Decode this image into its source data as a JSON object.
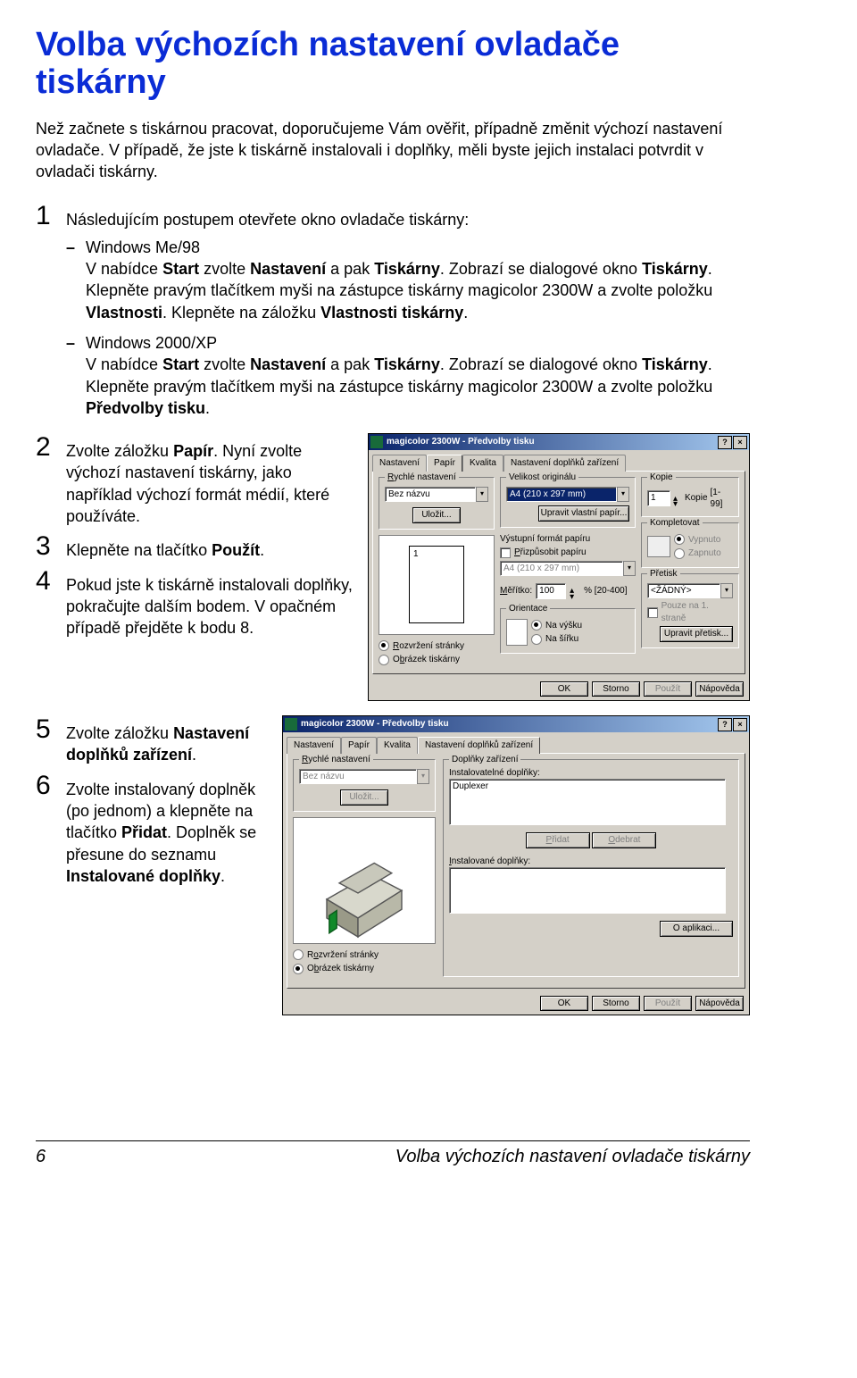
{
  "heading": "Volba výchozích nastavení ovladače tiskárny",
  "lead": "Než začnete s tiskárnou pracovat, doporučujeme Vám ověřit, případně změnit výchozí nastavení ovladače. V případě, že jste k tiskárně instalovali i doplňky, měli byste jejich instalaci potvrdit v ovladači tiskárny.",
  "step1": {
    "intro": "Následujícím postupem otevřete okno ovladače tiskárny:",
    "a_title": "Windows Me/98",
    "a_text_before_start": "V nabídce ",
    "a_start": "Start",
    "a_mid1": " zvolte ",
    "a_nastaveni": "Nastavení",
    "a_mid2": " a pak ",
    "a_tiskarny": "Tiskárny",
    "a_after1": ". Zobrazí se dialogové okno ",
    "a_tiskarny2": "Tiskárny",
    "a_after2": ". Klepněte pravým tlačítkem myši na zástupce tiskárny magicolor 2300W a zvolte položku ",
    "a_vlast": "Vlastnosti",
    "a_after3": ". Klepněte na záložku ",
    "a_vlast_tisk": "Vlastnosti tiskárny",
    "a_end": ".",
    "b_title": "Windows 2000/XP",
    "b_before": "V nabídce ",
    "b_start": "Start",
    "b_mid1": " zvolte ",
    "b_nastaveni": "Nastavení",
    "b_mid2": " a pak ",
    "b_tiskarny": "Tiskárny",
    "b_after1": ". Zobrazí se dialogové okno ",
    "b_tiskarny2": "Tiskárny",
    "b_after2": ". Klepněte pravým tlačítkem myši na zástupce tiskárny magicolor 2300W a zvolte položku ",
    "b_predvolby": "Předvolby tisku",
    "b_end": "."
  },
  "step2": {
    "before": "Zvolte záložku ",
    "papir": "Papír",
    "after": ". Nyní zvolte výchozí nastavení tiskárny, jako například výchozí formát médií, které používáte."
  },
  "step3": {
    "before": "Klepněte na tlačítko ",
    "pouzit": "Použít",
    "after": "."
  },
  "step4": "Pokud jste k tiskárně instalovali doplňky, pokračujte dalším bodem. V opačném případě přejděte k bodu 8.",
  "step5": {
    "before": "Zvolte záložku ",
    "nast": "Nastavení doplňků zařízení",
    "after": "."
  },
  "step6": {
    "t1": "Zvolte instalovaný doplněk (po jednom) a klepněte na tlačítko ",
    "pridat": "Přidat",
    "t2": ". Doplněk se přesune do seznamu ",
    "inst": "Instalované doplňky",
    "t3": "."
  },
  "dialog1": {
    "title": "magicolor 2300W - Předvolby tisku",
    "tabs": [
      "Nastavení",
      "Papír",
      "Kvalita",
      "Nastavení doplňků zařízení"
    ],
    "active_tab": 1,
    "quick_label": "Rychlé nastavení",
    "quick_value": "Bez názvu",
    "save_btn": "Uložit...",
    "orig_label": "Velikost originálu",
    "orig_value": "A4 (210 x 297 mm)",
    "custom_btn": "Upravit vlastní papír...",
    "out_label": "Výstupní formát papíru",
    "fit_chk": "Přizpůsobit papíru",
    "out_value": "A4 (210 x 297 mm)",
    "scale_label": "Měřítko:",
    "scale_value": "100",
    "scale_range": "%   [20-400]",
    "orient_label": "Orientace",
    "orient_portrait": "Na výšku",
    "orient_landscape": "Na šířku",
    "copies_label": "Kopie",
    "copies_value": "1",
    "copies_text": "Kopie",
    "copies_range": "[1-99]",
    "collate_label": "Kompletovat",
    "collate_off": "Vypnuto",
    "collate_on": "Zapnuto",
    "overlay_label": "Přetisk",
    "overlay_value": "<ŽÁDNÝ>",
    "overlay_first": "Pouze na 1. straně",
    "overlay_btn": "Upravit přetisk...",
    "layout_radio": "Rozvržení stránky",
    "image_radio": "Obrázek tiskárny",
    "page_one": "1",
    "buttons": [
      "OK",
      "Storno",
      "Použít",
      "Nápověda"
    ]
  },
  "dialog2": {
    "title": "magicolor 2300W - Předvolby tisku",
    "tabs": [
      "Nastavení",
      "Papír",
      "Kvalita",
      "Nastavení doplňků zařízení"
    ],
    "active_tab": 3,
    "quick_label": "Rychlé nastavení",
    "quick_value": "Bez názvu",
    "save_btn": "Uložit...",
    "dev_label": "Doplňky zařízení",
    "installable_label": "Instalovatelné doplňky:",
    "installable_item": "Duplexer",
    "add_btn": "Přidat",
    "remove_btn": "Odebrat",
    "installed_label": "Instalované doplňky:",
    "about_btn": "O aplikaci...",
    "layout_radio": "Rozvržení stránky",
    "image_radio": "Obrázek tiskárny",
    "buttons": [
      "OK",
      "Storno",
      "Použít",
      "Nápověda"
    ]
  },
  "footer": {
    "page": "6",
    "title": "Volba výchozích nastavení ovladače tiskárny"
  }
}
